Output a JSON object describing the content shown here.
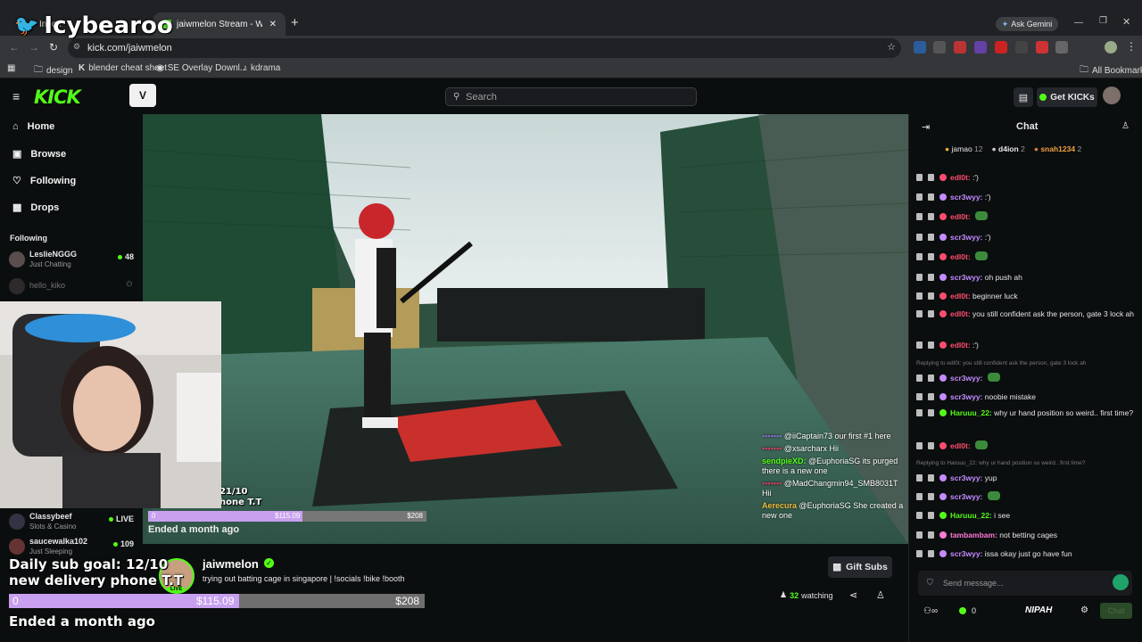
{
  "browser": {
    "tab_inactive_label": "Inbox",
    "tab_active_label": "jaiwmelon Stream - Watch L",
    "ask_gemini": "Ask Gemini",
    "url": "kick.com/jaiwmelon",
    "bookmarks": [
      "design",
      "blender cheat sheet",
      "SE Overlay Downl...",
      "kdrama"
    ],
    "all_bookmarks": "All Bookmarks"
  },
  "watermark": "Icybearoo",
  "header": {
    "search_placeholder": "Search",
    "get_kicks": "Get KICKs",
    "brand_color": "#53fc18"
  },
  "sidebar": {
    "nav": [
      {
        "label": "Home",
        "icon": "home-icon"
      },
      {
        "label": "Browse",
        "icon": "browse-icon"
      },
      {
        "label": "Following",
        "icon": "heart-icon"
      },
      {
        "label": "Drops",
        "icon": "gift-icon"
      }
    ],
    "following_heading": "Following",
    "channels_top": [
      {
        "name": "LeslieNGGG",
        "category": "Just Chatting",
        "count": "48"
      },
      {
        "name": "hello_kiko",
        "category": "",
        "count": ""
      }
    ],
    "channels_bottom": [
      {
        "name": "Classybeef",
        "category": "Slots & Casino",
        "count": "LIVE"
      },
      {
        "name": "saucewalka102",
        "category": "Just Sleeping",
        "count": "109"
      }
    ]
  },
  "video_overlay": {
    "sub_goal_small": "21/10",
    "delivery_small": "hone T.T",
    "bar_start": "0",
    "bar_mid": "$115.09",
    "bar_end": "$208",
    "ended": "Ended a month ago",
    "chat_lines": [
      {
        "user": "",
        "text": "@iiCaptain73 our first #1 here"
      },
      {
        "user": "",
        "text": "@xsarcharx Hii"
      },
      {
        "user": "sendpieXD:",
        "text": "@EuphoriaSG its purged there is a new one"
      },
      {
        "user": "",
        "text": "@MadChangmin94_SMB8031T Hii"
      },
      {
        "user": "Aerecura",
        "text": "@EuphoriaSG She created a new one"
      }
    ]
  },
  "big_overlay": {
    "goal": "Daily sub goal: 12/10",
    "delivery": "new delivery phone T.T",
    "bar_start": "0",
    "bar_mid": "$115.09",
    "bar_end": "$208",
    "ended": "Ended a month ago"
  },
  "stream": {
    "streamer": "jaiwmelon",
    "title": "trying out batting cage in singapore | !socials !bike !booth",
    "live_badge": "LIVE",
    "gift_subs": "Gift Subs",
    "watching_count": "32",
    "watching_label": "watching"
  },
  "chat": {
    "title": "Chat",
    "top_gifters": [
      {
        "name": "jamao",
        "count": "12"
      },
      {
        "name": "d4ion",
        "count": "2"
      },
      {
        "name": "snah1234",
        "count": "2"
      }
    ],
    "messages": [
      {
        "user": "edl0t:",
        "text": ":')",
        "color": "#ff4d6d"
      },
      {
        "user": "scr3wyy:",
        "text": ":')",
        "color": "#c58cff"
      },
      {
        "user": "edl0t:",
        "text": "",
        "color": "#ff4d6d"
      },
      {
        "user": "scr3wyy:",
        "text": ":')",
        "color": "#c58cff"
      },
      {
        "user": "edl0t:",
        "text": "",
        "color": "#ff4d6d"
      },
      {
        "user": "scr3wyy:",
        "text": "oh push ah",
        "color": "#c58cff"
      },
      {
        "user": "edl0t:",
        "text": "beginner luck",
        "color": "#ff4d6d"
      },
      {
        "user": "edl0t:",
        "text": "you still confident ask the person, gate 3 lock ah",
        "color": "#ff4d6d"
      },
      {
        "user": "edl0t:",
        "text": ":')",
        "color": "#ff4d6d"
      },
      {
        "user": "scr3wyy:",
        "text": "",
        "color": "#c58cff"
      },
      {
        "user": "scr3wyy:",
        "text": "noobie mistake",
        "color": "#c58cff"
      },
      {
        "user": "Haruuu_22:",
        "text": "why ur hand position so weird.. first time?",
        "color": "#53fc18"
      },
      {
        "user": "edl0t:",
        "text": "",
        "color": "#ff4d6d"
      },
      {
        "user": "scr3wyy:",
        "text": "yup",
        "color": "#c58cff"
      },
      {
        "user": "scr3wyy:",
        "text": "",
        "color": "#c58cff"
      },
      {
        "user": "Haruuu_22:",
        "text": "i see",
        "color": "#53fc18"
      },
      {
        "user": "tambambam:",
        "text": "not betting cages",
        "color": "#ff7ad9"
      },
      {
        "user": "scr3wyy:",
        "text": "issa okay just go have fun",
        "color": "#c58cff"
      }
    ],
    "reply_1": "Replying to edl0t: you still confident ask the person, gate 3 lock ah",
    "reply_2": "Replying to Haruuu_22: why ur hand position so weird.. first time?",
    "input_placeholder": "Send message...",
    "kicks_balance": "0",
    "send_label": "Chat",
    "nipah_label": "NIPAH"
  }
}
